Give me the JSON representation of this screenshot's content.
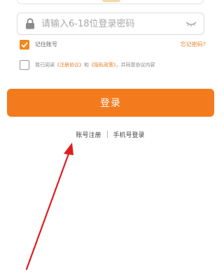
{
  "password": {
    "placeholder": "请输入6-18位登录密码",
    "lock_icon": "lock-icon",
    "visibility_icon": "eye-closed-icon"
  },
  "remember": {
    "checked": true,
    "label": "记住账号",
    "forgot_label": "忘记密码?"
  },
  "agreement": {
    "checked": false,
    "prefix": "我已阅读",
    "terms_link": "《注册协议》",
    "conjunction": "和",
    "privacy_link": "《隐私政策》",
    "suffix": "，并同意协议内容"
  },
  "login_label": "登录",
  "bottom_links": {
    "register": "账号注册",
    "phone_login": "手机号登录"
  },
  "colors": {
    "accent": "#f37b1d",
    "link": "#e8822a",
    "annotation": "#e01d1d"
  }
}
